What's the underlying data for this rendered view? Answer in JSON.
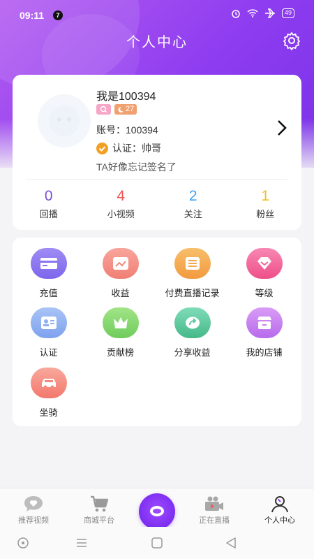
{
  "status_bar": {
    "time": "09:11",
    "notification_count": "7",
    "battery": "49"
  },
  "header": {
    "title": "个人中心"
  },
  "profile": {
    "nickname": "我是100394",
    "level": "27",
    "account": "账号：100394",
    "certification": "认证：帅哥",
    "signature": "TA好像忘记签名了"
  },
  "stats": [
    {
      "value": "0",
      "label": "回播",
      "color": "#7b4fd6"
    },
    {
      "value": "4",
      "label": "小视频",
      "color": "#f0544f"
    },
    {
      "value": "2",
      "label": "关注",
      "color": "#3fa0f0"
    },
    {
      "value": "1",
      "label": "粉丝",
      "color": "#f0c020"
    }
  ],
  "menu": [
    {
      "label": "充值",
      "icon": "card-icon",
      "color": "#8a74f0"
    },
    {
      "label": "收益",
      "icon": "chart-icon",
      "color": "#f58a80"
    },
    {
      "label": "付费直播记录",
      "icon": "list-icon",
      "color": "#f5a850"
    },
    {
      "label": "等级",
      "icon": "diamond-icon",
      "color": "#f2669a"
    },
    {
      "label": "认证",
      "icon": "id-card-icon",
      "color": "#8fb0f2"
    },
    {
      "label": "贡献榜",
      "icon": "crown-icon",
      "color": "#8ad870"
    },
    {
      "label": "分享收益",
      "icon": "share-icon",
      "color": "#5fc8a0"
    },
    {
      "label": "我的店铺",
      "icon": "store-icon",
      "color": "#c87ef0"
    },
    {
      "label": "坐骑",
      "icon": "car-icon",
      "color": "#f58a7a"
    }
  ],
  "tabbar": {
    "tabs": [
      {
        "label": "推荐视频",
        "icon": "heart-chat-icon"
      },
      {
        "label": "商城平台",
        "icon": "cart-icon"
      },
      {
        "label": "正在直播",
        "icon": "live-camera-icon"
      },
      {
        "label": "个人中心",
        "icon": "person-icon"
      }
    ],
    "active": "个人中心"
  }
}
